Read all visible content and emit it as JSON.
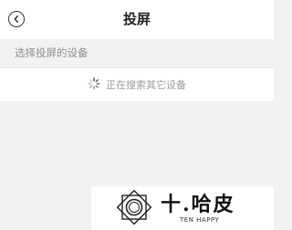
{
  "header": {
    "title": "投屏",
    "back_icon": "chevron-left-icon"
  },
  "section": {
    "label": "选择投屏的设备"
  },
  "status": {
    "icon": "loading-spinner-icon",
    "text": "正在搜索其它设备"
  },
  "watermark": {
    "brand_cn": "十.哈皮",
    "brand_en": "TEN HAPPY"
  },
  "colors": {
    "page_bg": "#f2f2f2",
    "surface": "#ffffff",
    "title": "#222222",
    "muted_text": "#8f8f8f",
    "status_text": "#9a9a9a"
  }
}
